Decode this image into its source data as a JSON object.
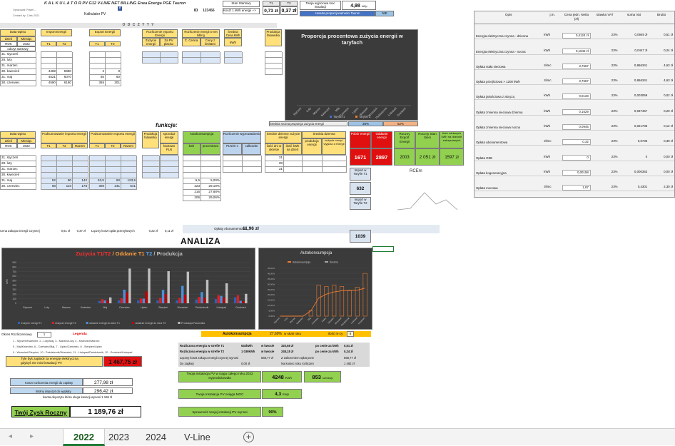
{
  "header": {
    "title": "K A L K U L A T O R  PV G12 V-LINE NET BILLING Enea Energa PGE Tauron",
    "sub1": "Opracował: Paweł ...",
    "sub2": "Created by: Z,ielu 2021",
    "kalk": "Kalkulator PV",
    "id_label": "ID",
    "id_value": "123456",
    "stan_label": "Stan Startowy",
    "kwh_label": "Koszt 1 kWh energii -->",
    "price1": "0,73 zł",
    "price2": "0,37 zł",
    "t1": "T1",
    "t2": "T2",
    "power_label": "Twoja wyjściowa moc instalacji",
    "power_value": "4,98",
    "power_unit": "kWp",
    "tariff_label": "zasada proporcjonalności Tauron",
    "tariff_value": "NIE",
    "odczyty": "O D C Z Y T Y"
  },
  "top_table": {
    "headers": {
      "date": "Data wpisu",
      "import": "Import Energii",
      "export": "Export Energii",
      "rozlicz": "Rozliczenie Importu Energii",
      "rozlicz2": "Rozliczenie energii w net billing",
      "srednia": "Średnia Cena kWh",
      "prod": "Produkcja falownika",
      "day": "dzień",
      "month": "Miesiąc",
      "year": "ROK",
      "yearval": "2022",
      "sub": "odczyt startowy",
      "t1": "T1",
      "t2": "T2",
      "zuz": "Zużycie energii",
      "zaplat": "Za PV płacisz",
      "cena": "Ć. Cenna",
      "ceny": "Ceny z limitami",
      "kwh": "kWh"
    },
    "months": [
      "31. styczeń",
      "28. luty",
      "31. marzec",
      "30. kwiecień",
      "31. maj",
      "30. czerwiec",
      "31. lipiec",
      "31. sierpień",
      "30. wrzesień",
      "31. październik",
      "30. listopad",
      "31. grudzień"
    ],
    "imp_t1": [
      "",
      "",
      "",
      "4469",
      "4521",
      "4590",
      "4655",
      "4715",
      "4780",
      "4873",
      "4968",
      "5101"
    ],
    "imp_t2": [
      "",
      "",
      "",
      "5980",
      "6070",
      "6180",
      "6285",
      "6403",
      "6524",
      "6664",
      "6841",
      "7019"
    ],
    "exp_t1": [
      "",
      "",
      "",
      "2",
      "65",
      "365",
      "468",
      "905",
      "1289",
      "1538",
      "1703",
      "1758"
    ],
    "exp_t2": [
      "",
      "",
      "",
      "0",
      "60",
      "301",
      "562",
      "770",
      "956",
      "1081",
      "1211",
      "1260"
    ],
    "r1": [
      "",
      "",
      "",
      "",
      "47,88 zł",
      "61,26 zł",
      "58,05 zł",
      "58,62 zł",
      "60,42 zł",
      "80,62 zł",
      "90,47 zł",
      "109,98 zł"
    ],
    "r2": [
      "",
      "",
      "",
      "",
      "23,48 zł",
      "29,80 zł",
      "28,34 zł",
      "29,00 zł",
      "30,49 zł",
      "39,17 zł",
      "44,59 zł",
      "53,03 zł"
    ],
    "r3": [
      "",
      "",
      "",
      "",
      "0,0 zł",
      "0,0 zł",
      "0,0 zł",
      "0,0 zł",
      "0,0 zł",
      "0,0 zł",
      "0,0 zł",
      "0,0 zł"
    ],
    "r4": [
      "",
      "",
      "",
      "",
      "35,44 zł",
      "41,85 zł",
      "40,30 zł",
      "46,96 zł",
      "42,45 zł",
      "51,13 zł",
      "56,55 zł",
      "76,78 zł"
    ],
    "r5": [
      "",
      "",
      "",
      "",
      "0,60 zł",
      "0,74 zł",
      "0,55 zł",
      "1,02 zł",
      "0,74 zł",
      "0,55 zł",
      "0,45 zł",
      "0,32 zł"
    ],
    "prod": [
      "",
      "",
      "",
      "",
      "130",
      "768",
      "768",
      "710",
      "700",
      "520",
      "442",
      "209"
    ],
    "funk": "funkcje:"
  },
  "pie_chart": {
    "title": "Proporcja procentowa zużycia energii w taryfach",
    "months": [
      "Styczeń",
      "Luty",
      "Marzec",
      "Kwiecień",
      "Maj",
      "Czerwiec",
      "Lipiec",
      "Sierpień",
      "Wrzesień",
      "Październik",
      "Listopad",
      "Grudzień"
    ],
    "legend1": "TaryfaT1",
    "legend2": "TaryfaT2",
    "footer": "Średnia roczna proporcja zużycia energii",
    "pct1": "38%",
    "pct2": "62%",
    "t1_color": "#4472c4",
    "t2_color": "#ed7d31"
  },
  "rates": {
    "headers": [
      "Opis",
      "j.m.",
      "Cena jedn. Netto (zł)",
      "stawka VAT",
      "suma Vat",
      "Brutto"
    ],
    "rows": [
      {
        "desc": "Energia elektryczna czynna - dzienna",
        "unit": "kWh",
        "price": "0,4124 zł",
        "vat": "23%",
        "sum": "0,0949 zł",
        "gross": "0,51 zł"
      },
      {
        "desc": "Energia elektryczna czynna - nocna",
        "unit": "kWh",
        "price": "0,1942 zł",
        "vat": "23%",
        "sum": "0,0447 zł",
        "gross": "0,24 zł"
      },
      {
        "desc": "Opłata stała sieciowa",
        "unit": "zł/mc",
        "price": "3,7667",
        "vat": "23%",
        "sum": "0,866341",
        "gross": "4,63 zł"
      },
      {
        "desc": "Opłata przejściowa > 1200 kWh",
        "unit": "zł/mc",
        "price": "3,7667",
        "vat": "23%",
        "sum": "0,866341",
        "gross": "4,63 zł"
      },
      {
        "desc": "Opłata jakościowa z akcyzą",
        "unit": "kWh",
        "price": "0,0133",
        "vat": "23%",
        "sum": "0,003059",
        "gross": "0,02 zł"
      },
      {
        "desc": "Opłata zmienna sieciowa dzienna",
        "unit": "kWh",
        "price": "0,1629",
        "vat": "23%",
        "sum": "0,037467",
        "gross": "0,20 zł"
      },
      {
        "desc": "Opłata zmienna sieciowa nocna",
        "unit": "kWh",
        "price": "0,0945",
        "vat": "23%",
        "sum": "0,021735",
        "gross": "0,12 zł"
      },
      {
        "desc": "Opłata abonamentowa",
        "unit": "zł/mc",
        "price": "0,32",
        "vat": "23%",
        "sum": "0,0736",
        "gross": "0,39 zł"
      },
      {
        "desc": "Opłata OZE",
        "unit": "kWh",
        "price": "0",
        "vat": "23%",
        "sum": "0",
        "gross": "0,00 zł"
      },
      {
        "desc": "Opłata kogeneracyjna",
        "unit": "kWh",
        "price": "0,00158",
        "vat": "23%",
        "sum": "0,000363",
        "gross": "0,00 zł"
      },
      {
        "desc": "Opłata mocowa",
        "unit": "zł/mc",
        "price": "1,87",
        "vat": "23%",
        "sum": "0,4301",
        "gross": "2,30 zł"
      }
    ]
  },
  "bottom_table": {
    "h_date": "Data wpisu",
    "h_podsum_imp": "Podsumowanie importu energii",
    "h_podsum_exp": "Podsumowanie exportu energii",
    "h_prod": "Produkcja falownika",
    "h_sprz": "sprzedaż energii",
    "h_auto": "Autokonsumpcja",
    "h_rozl": "Rozliczenie wyprowadzenia",
    "h_sred": "Średnie dzienne zużycie energii",
    "h_sred2": "Średnia dzienna",
    "h_kwh": "kwh",
    "h_proc": "procentowo",
    "h_pln": "PLN/m-c",
    "h_calk": "całkowite",
    "h_razem": "Razem",
    "h_kwota": "kwotowo PLN",
    "h_ilosc": "ilość dni w okresie",
    "h_ilosc2": "ilość kWh na dzień",
    "h_prodd": "produkcja energii",
    "h_zuz": "zużycie mocy i wyjścia z energii",
    "imp_t1": [
      "",
      "",
      "",
      "",
      "52",
      "68",
      "65",
      "65",
      "65",
      "85",
      "95",
      "133"
    ],
    "imp_t2": [
      "",
      "",
      "",
      "",
      "90",
      "110",
      "105",
      "118",
      "121",
      "140",
      "177",
      "178"
    ],
    "imp_r": [
      "",
      "",
      "",
      "",
      "142",
      "178",
      "170",
      "183",
      "186",
      "225",
      "272",
      "311"
    ],
    "exp_t1": [
      "",
      "",
      "",
      "",
      "63,5",
      "300",
      "103",
      "296",
      "384",
      "249",
      "165",
      "55"
    ],
    "exp_t2": [
      "",
      "",
      "",
      "",
      "60",
      "241",
      "261",
      "208",
      "186",
      "125",
      "130",
      "49"
    ],
    "exp_r": [
      "",
      "",
      "",
      "",
      "123,5",
      "541",
      "364",
      "504",
      "570",
      "374",
      "295",
      "104"
    ],
    "prod": [
      "",
      "",
      "",
      "",
      "130",
      "768",
      "768",
      "710",
      "700",
      "520",
      "442",
      "209"
    ],
    "sprz": [
      "",
      "",
      "",
      "",
      "7,41 zł",
      "7,95 zł",
      "7,82 zł",
      "7,73 zł",
      "7,74 zł",
      "7,84 zł",
      "7,96 zł",
      "7,96 zł"
    ],
    "auto_kwh": [
      "",
      "",
      "",
      "",
      "6,5",
      "223",
      "216",
      "206",
      "198",
      "126",
      "120",
      "74"
    ],
    "auto_pct": [
      "",
      "",
      "",
      "",
      "5,00%",
      "29,19%",
      "27,88%",
      "29,06%",
      "27,97%",
      "24,23%",
      "27,11%",
      "40,22%"
    ],
    "pln": [
      "",
      "",
      "",
      "",
      "26,4 zł",
      "339 zł",
      "252 zł",
      "456 zł",
      "316 zł",
      "135 zł",
      "42 zł",
      "40 zł"
    ],
    "calk": [
      "",
      "",
      "",
      "",
      "26",
      "365 zł",
      "617 zł",
      "1 074 zł",
      "1 389 zł",
      "1 525 zł",
      "1 557 zł",
      "1 597 zł"
    ],
    "dni": [
      "31",
      "28",
      "31",
      "30",
      "31",
      "30",
      "31",
      "31",
      "30",
      "31",
      "30",
      "31"
    ],
    "kwhd": [
      "",
      "",
      "",
      "",
      "4,79",
      "13,60",
      "12,52",
      "12,90",
      "12,80",
      "12,19",
      "16,37",
      "12,42"
    ],
    "prodd": [
      "",
      "",
      "",
      "",
      "6,19",
      "25,60",
      "25,23",
      "23,03",
      "23,68",
      "16,77",
      "18,90",
      "5,94"
    ],
    "zuzd": [
      "",
      "",
      "",
      "",
      "0,84",
      "5,11",
      "5,07",
      "4,62",
      "4,76",
      "3,37",
      "3,39",
      "1,19"
    ],
    "opl_label": "Opłaty Abonamentowe",
    "opl_val": "11,96 zł",
    "sum_label": "Cena Zakupu Energii Czynnej",
    "sum1": "0,61 zł",
    "sum2": "0,37 zł",
    "sum3": "Łączny koszt opłat przesyłowych",
    "sum4": "0,22 zł",
    "sum5": "0,11 zł"
  },
  "kpi": {
    "h1": "Pobór energii",
    "h2": "Oddanie energii",
    "h3": "Roczny Export Energii",
    "h4": "Roczny Stan Sieci",
    "h5": "ilość oddanych kWh na obecnie zatrzymanych",
    "v1": "1671",
    "v2": "2897",
    "v3": "2003",
    "v4": "2 051 zł",
    "v5": "1597 zł",
    "imp_t1_label": "Import w Taryfie T1",
    "imp_t1_val": "632",
    "imp_t2_label": "Import w Taryfie T2",
    "imp_t2_val": "1039",
    "rcem": "RCEm"
  },
  "analiza_title": "ANALIZA",
  "bar_chart": {
    "title_a": "Zużycia T1/T2",
    "title_b": " / Oddanie T1 ",
    "title_c": "T2",
    "title_d": " / Produkcja",
    "months": [
      "Styczeń",
      "Luty",
      "Marzec",
      "Kwiecień",
      "Maj",
      "Czerwiec",
      "Lipiec",
      "Sierpień",
      "Wrzesień",
      "Październik",
      "Listopad",
      "Grudzień"
    ],
    "ymax": 900,
    "ylabel": "kWh",
    "ticks": [
      "900",
      "800",
      "700",
      "600",
      "500",
      "400",
      "300",
      "200",
      "100",
      "0"
    ],
    "series": [
      {
        "name": "Zużycie energii T1",
        "color": "#2f5fb5",
        "values": [
          0,
          0,
          0,
          0,
          52,
          68,
          65,
          65,
          65,
          85,
          95,
          133
        ]
      },
      {
        "name": "Zużycie energii T2",
        "color": "#e02020",
        "values": [
          0,
          0,
          0,
          0,
          90,
          110,
          105,
          118,
          121,
          140,
          177,
          178
        ]
      },
      {
        "name": "oddanie energii do sieci T1",
        "color": "#4a90d9",
        "values": [
          0,
          0,
          0,
          0,
          64,
          300,
          103,
          296,
          384,
          249,
          165,
          55
        ]
      },
      {
        "name": "oddanie energii do sieci T2",
        "color": "#c00000",
        "values": [
          0,
          0,
          0,
          0,
          60,
          241,
          261,
          208,
          186,
          125,
          130,
          49
        ]
      },
      {
        "name": "Produkcja Falownika",
        "color": "#bfbfbf",
        "values": [
          0,
          0,
          0,
          0,
          130,
          768,
          768,
          710,
          700,
          520,
          442,
          209
        ]
      }
    ]
  },
  "auto_chart": {
    "title": "Autokonsumpcja",
    "legend1": "Autokonsumpcja",
    "legend2": "Średnia",
    "months": [
      "Styczeń",
      "Luty",
      "Marzec",
      "Kwiecień",
      "Maj",
      "Czerwiec",
      "Lipiec",
      "Sierpień",
      "Wrzesień",
      "Październik",
      "Listopad",
      "Grudzień"
    ],
    "ticks": [
      "45,00%",
      "40,00%",
      "35,00%",
      "30,00%",
      "25,00%",
      "20,00%",
      "15,00%",
      "10,00%",
      "5,00%",
      "0,00%"
    ],
    "ymax": 45,
    "bars": [
      0,
      0,
      0,
      0,
      5,
      29.19,
      27.88,
      29.06,
      27.97,
      24.23,
      27.11,
      40.22
    ],
    "avg": [
      0,
      0,
      0,
      0,
      5,
      17,
      20.7,
      22.8,
      23.9,
      23.9,
      24.4,
      26.4
    ],
    "bar_color": "#ed7d31",
    "avg_color": "#a5a5a5"
  },
  "summary": {
    "okres_label": "Okres Rozliczeniowy",
    "okres_val": "1",
    "legend": "Legenda",
    "legend_lines": [
      "1 - Styczeń/Kwiecień, 2 - Luty/Maj, 3 - Marzec/Luty, 4 - Kwiecień/Marzec",
      "5 - Maj/Kwiecień, 6 - Czerwiec/Maj, 7 - Lipiec/Czerwiec, 8 - Sierpień/Lipiec",
      "9 - Wrzesień/Sierpień, 10 - Październik/Wrzesień, 11 - Listopad/Październik, 12 - Grudzień/Listopad"
    ],
    "auto_label": "Autokonsumpcja",
    "auto_pct": "27,69%",
    "auto_sub": "w skali roku",
    "auto_m": "ilość m-cy",
    "auto_mv": "8",
    "paid_label": "Tyle byś zapłacił za energię elektryczną gdybyś nie miał instalacji PV",
    "paid_val": "1 467,75 zł",
    "net_rows": [
      {
        "a": "Rozliczona energia w strefie T1",
        "b": "632kWh",
        "c": "w kwocie",
        "d": "320,58 zł",
        "e": "po cenie za kWh",
        "f": "0,51 zł"
      },
      {
        "a": "Rozliczona energia w strefie T2",
        "b": "1 039kWh",
        "c": "w kwocie",
        "d": "248,18 zł",
        "e": "po cenie za kWh",
        "f": "0,24 zł"
      },
      {
        "a": "Łączny koszt zakupu energii czynnej wynosi",
        "b": "",
        "c": "568,77 zł",
        "d": "Z zaliczeniem opłat przesyłowych",
        "e": "",
        "f": "568,77 zł"
      },
      {
        "a": "Do zapłaty",
        "b": "0,00 zł",
        "c": "",
        "d": "Na koniec roku rozliczeniowego w depozycie pozostało",
        "e": "",
        "f": "1 492 zł"
      }
    ],
    "pv_year_label": "Twoja instalacja PV w ciągu całego roku 2022 wyprodukowała",
    "pv_year_val": "4248",
    "pv_year_unit": "Kwh",
    "pv_kwp_val": "853",
    "pv_kwp_unit": "kwh/kwp",
    "koszt_label": "Koszt rozliczenia energii do zapłaty",
    "koszt_val": "277,98 zł",
    "depozyt_label": "Wolny depozyt do wypłaty",
    "depozyt_val": "296,42 zł",
    "depozyt_note": "kwota depozytu która ulega kasacji wynosi  1 186 zł",
    "moc_label": "Twoja Instalacja PV osiąga MOC",
    "moc_val": "4,3",
    "moc_unit": "Kwp",
    "zysk_label": "Twój Zysk Roczny",
    "zysk_val": "1 189,76 zł",
    "spr_label": "Sprawność twojej instalacji PV wynosi",
    "spr_val": "90%"
  },
  "tabs": [
    "2022",
    "2023",
    "2024",
    "V-Line"
  ],
  "active_tab": "2022"
}
